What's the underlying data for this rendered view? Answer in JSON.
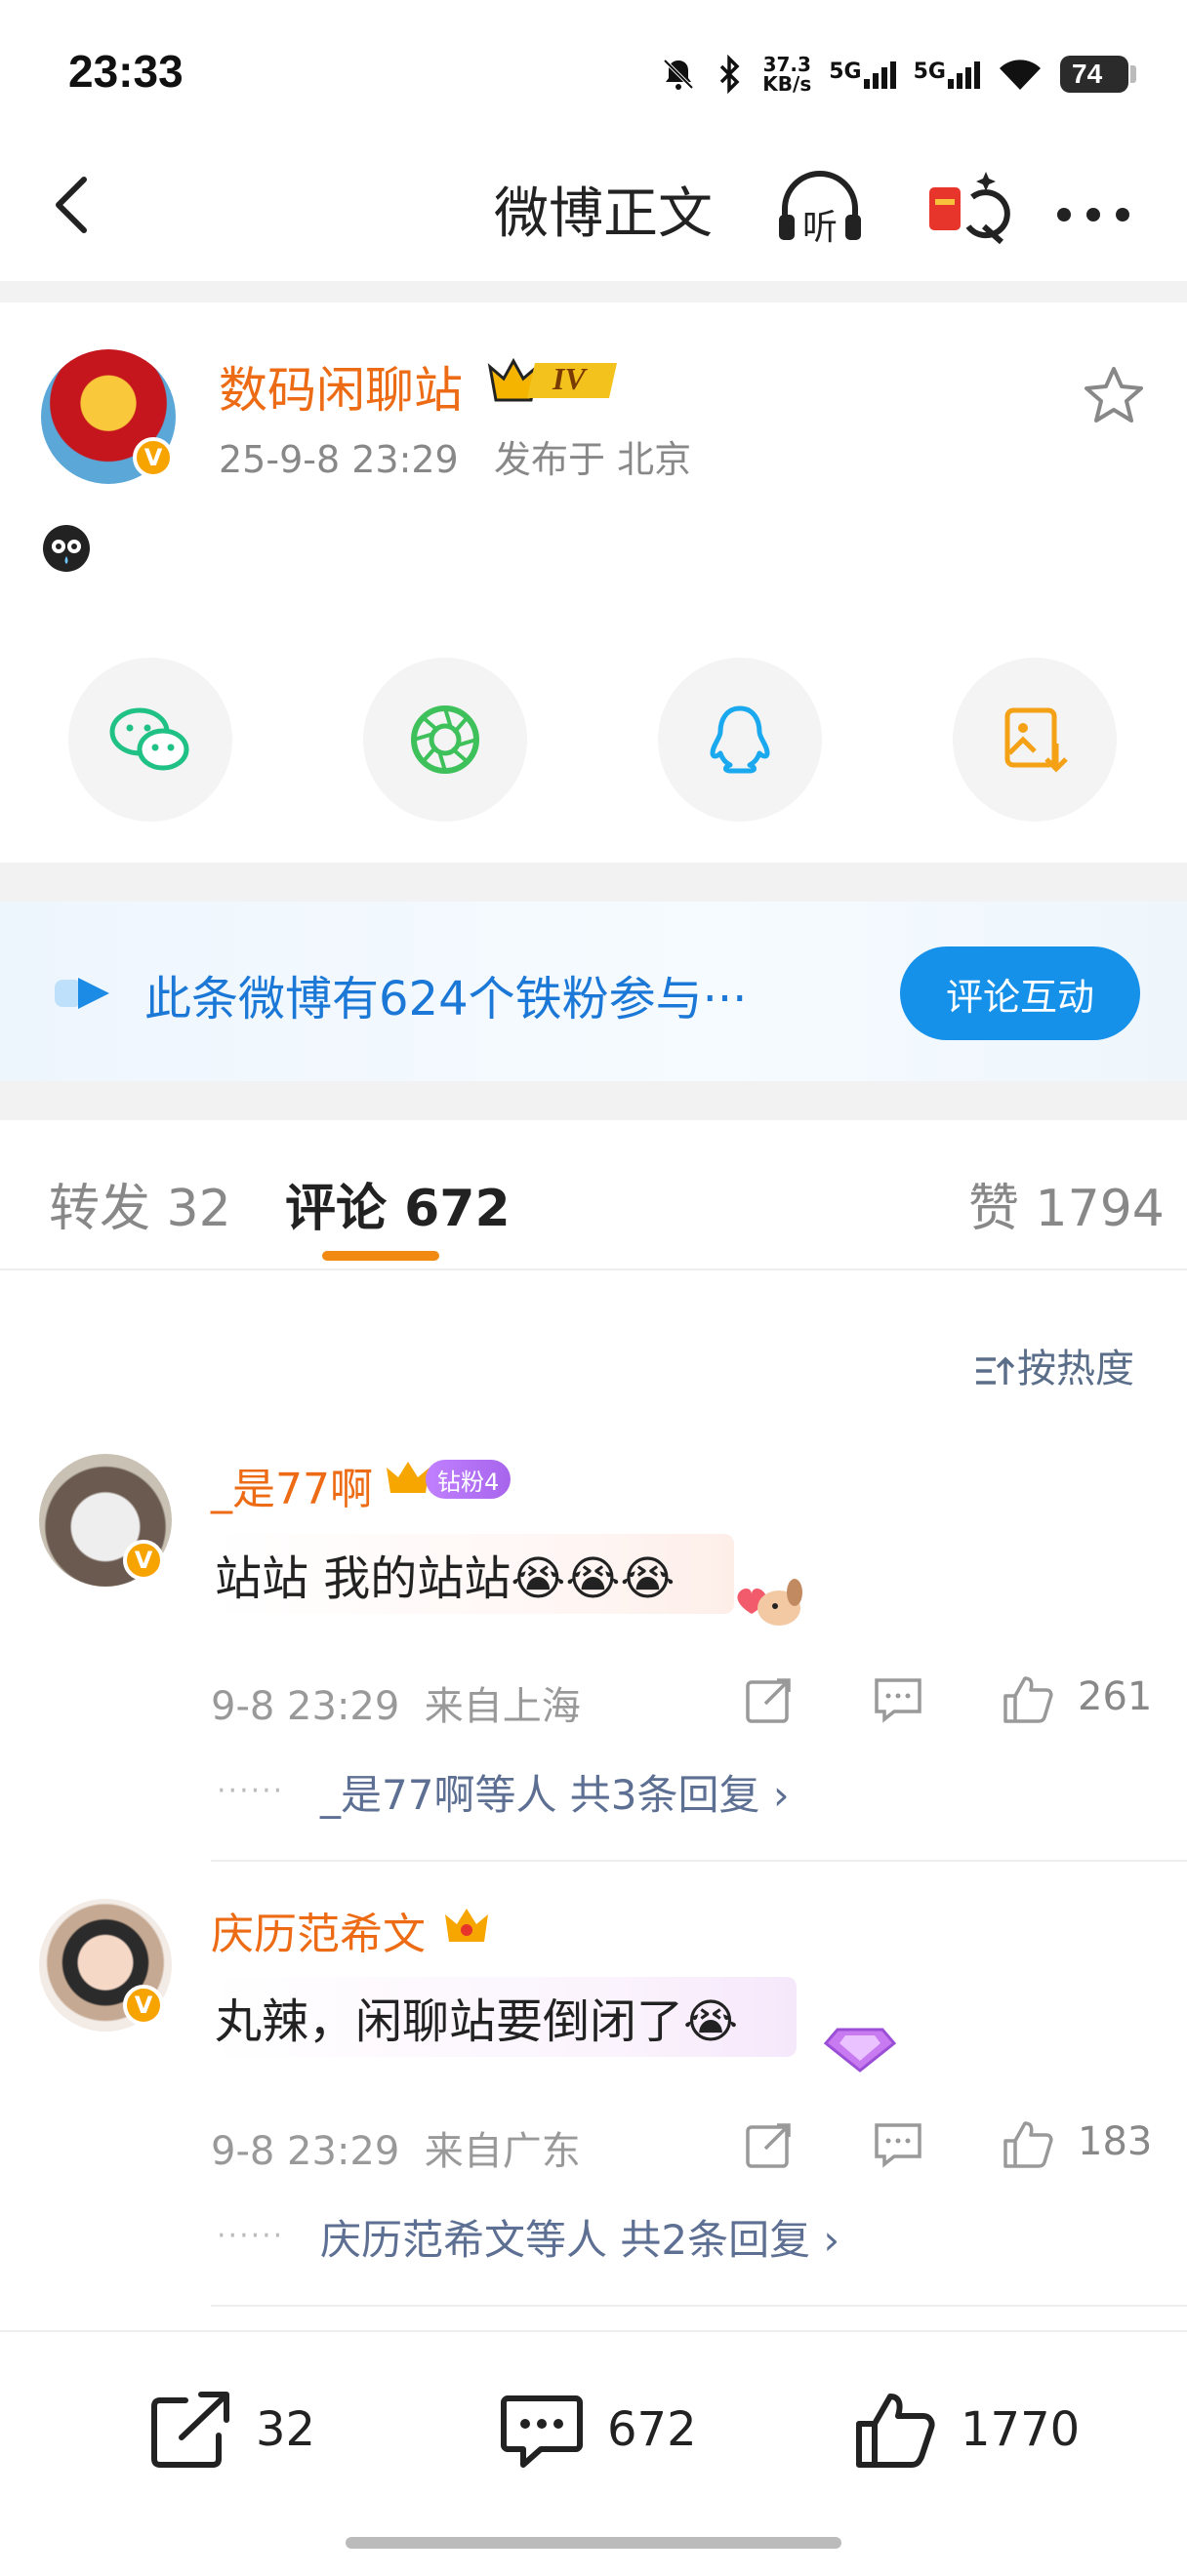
{
  "status_bar": {
    "time": "23:33",
    "net_speed": "37.3",
    "net_unit": "KB/s",
    "signal1": "5G",
    "signal2": "5G",
    "battery": "74"
  },
  "header": {
    "title": "微博正文",
    "listen_label": "听"
  },
  "post": {
    "author": "数码闲聊站",
    "level_badge": "IV",
    "timestamp": "25-9-8 23:29",
    "location": "发布于 北京"
  },
  "fans_banner": {
    "text": "此条微博有624个铁粉参与···",
    "button": "评论互动"
  },
  "tabs": {
    "repost": "转发 32",
    "comment": "评论 672",
    "like": "赞 1794"
  },
  "sort_label": "按热度",
  "comments": [
    {
      "name": "_是77啊",
      "badge": "钻粉4",
      "text": "站站 我的站站😭😭😭",
      "time": "9-8 23:29",
      "source": "来自上海",
      "likes": "261",
      "reply_summary": "_是77啊等人  共3条回复"
    },
    {
      "name": "庆历范希文",
      "text": "丸辣，闲聊站要倒闭了😭",
      "time": "9-8 23:29",
      "source": "来自广东",
      "likes": "183",
      "reply_summary": "庆历范希文等人  共2条回复"
    }
  ],
  "bottom_bar": {
    "repost_count": "32",
    "comment_count": "672",
    "like_count": "1770"
  },
  "colors": {
    "accent_orange": "#ec6b14",
    "link_blue": "#5d6f92",
    "primary_blue": "#1691ea"
  }
}
